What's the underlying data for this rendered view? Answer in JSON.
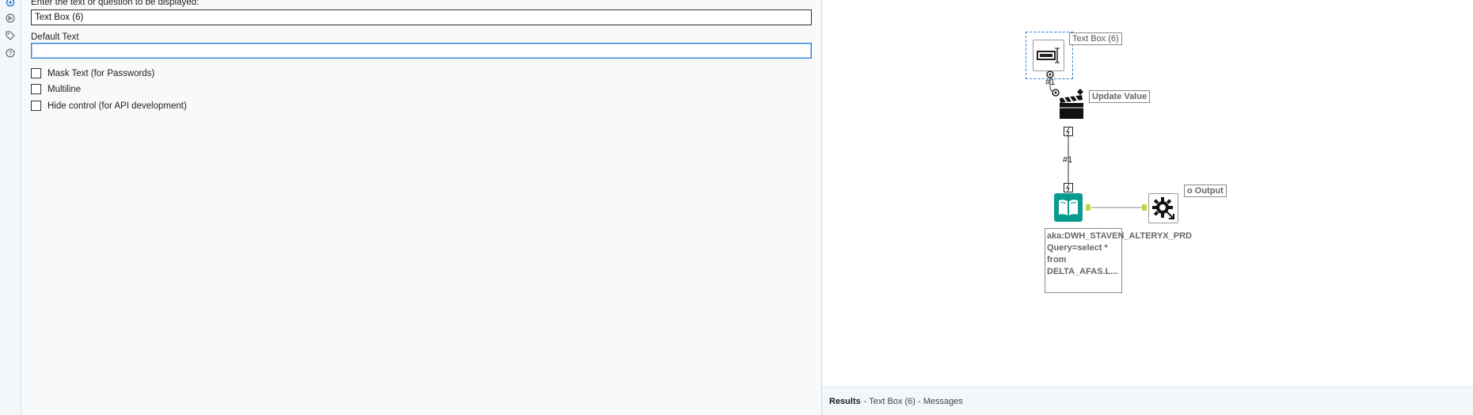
{
  "config": {
    "question_label": "Enter the text or question to be displayed:",
    "question_value": "Text Box (6)",
    "default_text_label": "Default Text",
    "default_text_value": "",
    "checkboxes": [
      {
        "label": "Mask Text (for Passwords)",
        "checked": false
      },
      {
        "label": "Multiline",
        "checked": false
      },
      {
        "label": "Hide control (for API development)",
        "checked": false
      }
    ]
  },
  "rail": {
    "icons": [
      "settings-icon",
      "annotation-icon",
      "tag-icon",
      "help-icon"
    ]
  },
  "canvas": {
    "textbox_tool": {
      "annotation": "Text Box (6)"
    },
    "update_value_tool": {
      "annotation": "Update Value"
    },
    "connection_label_1": "#1",
    "connection_label_2": "#1",
    "input_tool": {
      "annotation": "aka:DWH_STAVEN_ALTERYX_PRD Query=select * from DELTA_AFAS.L..."
    },
    "output_tool": {
      "annotation": "o Output"
    }
  },
  "results": {
    "title": "Results",
    "subtitle": "- Text Box (6) - Messages"
  },
  "colors": {
    "accent": "#2a7fd4",
    "teal": "#0a9b8f",
    "anchor": "#b8d94a"
  }
}
